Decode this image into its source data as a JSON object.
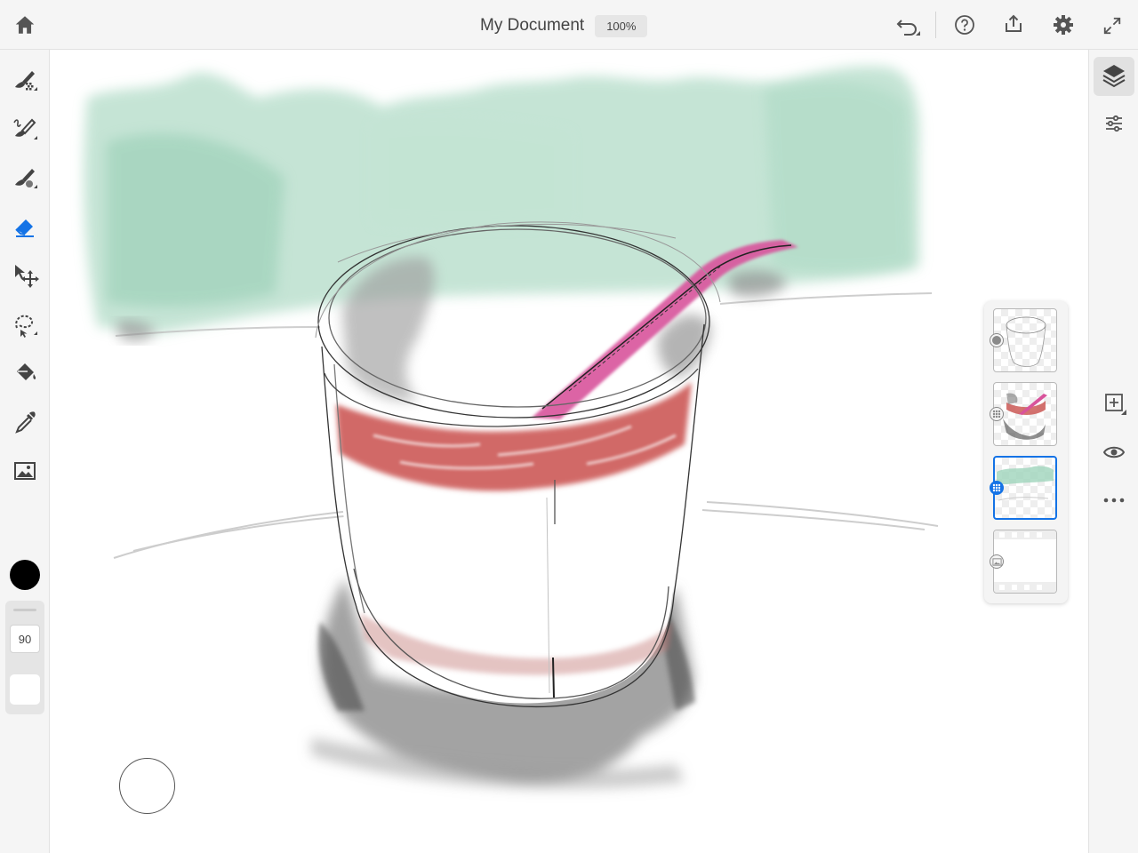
{
  "header": {
    "document_title": "My Document",
    "zoom_level": "100%"
  },
  "left_toolbar": {
    "tools": [
      {
        "name": "pixel-brush",
        "icon": "pixel-brush-icon"
      },
      {
        "name": "live-brush",
        "icon": "live-brush-icon"
      },
      {
        "name": "vector-brush",
        "icon": "vector-brush-icon"
      },
      {
        "name": "eraser",
        "icon": "eraser-icon",
        "active": true
      },
      {
        "name": "transform",
        "icon": "move-icon"
      },
      {
        "name": "selection",
        "icon": "lasso-icon"
      },
      {
        "name": "fill",
        "icon": "paint-bucket-icon"
      },
      {
        "name": "eyedropper",
        "icon": "eyedropper-icon"
      },
      {
        "name": "image",
        "icon": "image-icon"
      }
    ],
    "color": "#000000",
    "brush_size": "90"
  },
  "right_toolbar": {
    "items": [
      "layers-icon",
      "properties-icon",
      "add-layer-icon",
      "visibility-eye-icon",
      "more-icon"
    ]
  },
  "layers": [
    {
      "type": "vector",
      "active": false
    },
    {
      "type": "live-paint",
      "active": false
    },
    {
      "type": "pixel",
      "active": true
    },
    {
      "type": "image-background",
      "active": false
    }
  ],
  "colors": {
    "accent": "#1473e6",
    "toolbar_bg": "#f5f5f5",
    "sketch_green": "#9fd4bb",
    "sketch_red": "#c94747",
    "sketch_pink": "#d33d8c"
  }
}
